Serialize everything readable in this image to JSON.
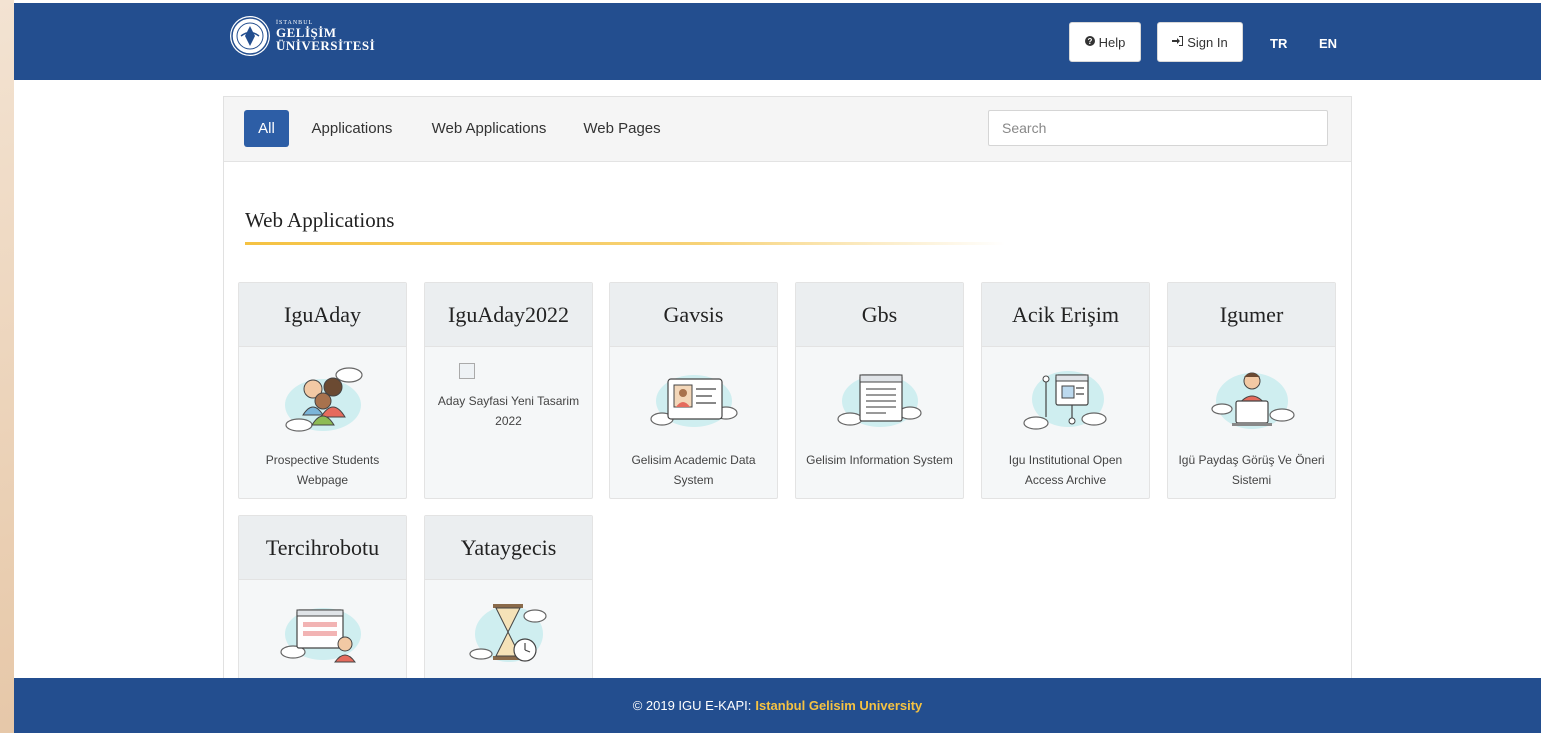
{
  "header": {
    "logo_small": "İSTANBUL",
    "logo_line1": "GELİŞİM",
    "logo_line2": "ÜNİVERSİTESİ",
    "help_label": "Help",
    "signin_label": "Sign In",
    "lang_tr": "TR",
    "lang_en": "EN",
    "help_icon": "question-circle-icon",
    "signin_icon": "sign-in-icon"
  },
  "filters": {
    "tabs": [
      {
        "label": "All",
        "active": true
      },
      {
        "label": "Applications",
        "active": false
      },
      {
        "label": "Web Applications",
        "active": false
      },
      {
        "label": "Web Pages",
        "active": false
      }
    ],
    "search_placeholder": "Search"
  },
  "section": {
    "title": "Web Applications"
  },
  "apps": [
    {
      "title": "IguAday",
      "desc": "Prospective Students Webpage",
      "icon": "students-icon"
    },
    {
      "title": "IguAday2022",
      "desc": "",
      "broken_img_alt": "Aday Sayfasi Yeni Tasarim 2022",
      "icon": "broken-image-icon"
    },
    {
      "title": "Gavsis",
      "desc": "Gelisim Academic Data System",
      "icon": "id-card-icon"
    },
    {
      "title": "Gbs",
      "desc": "Gelisim Information System",
      "icon": "document-window-icon"
    },
    {
      "title": "Acik Erişim",
      "desc": "Igu Institutional Open Access Archive",
      "icon": "archive-network-icon"
    },
    {
      "title": "Igumer",
      "desc": "Igü Paydaş Görüş Ve Öneri Sistemi",
      "icon": "person-laptop-icon"
    },
    {
      "title": "Tercihrobotu",
      "desc": "",
      "icon": "robot-browser-icon"
    },
    {
      "title": "Yataygecis",
      "desc": "",
      "icon": "hourglass-icon"
    }
  ],
  "footer": {
    "text": "© 2019 IGU E-KAPI:",
    "highlight": "Istanbul Gelisim University"
  },
  "colors": {
    "navbar": "#234e8f",
    "accent": "#f5c242",
    "active_pill": "#2d5ea6"
  }
}
